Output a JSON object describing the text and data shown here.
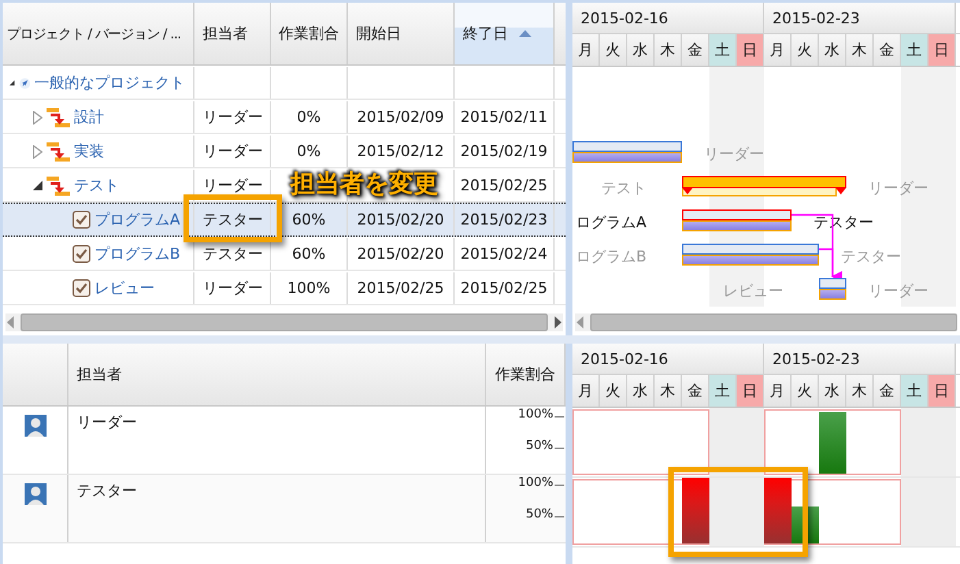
{
  "top_grid": {
    "columns": [
      {
        "label": "プロジェクト / バージョン / ...",
        "sorted": false
      },
      {
        "label": "担当者",
        "sorted": false
      },
      {
        "label": "作業割合",
        "sorted": false
      },
      {
        "label": "開始日",
        "sorted": false
      },
      {
        "label": "終了日",
        "sorted": true
      }
    ],
    "rows": [
      {
        "kind": "project",
        "name": "一般的なプロジェクト",
        "expanded": true,
        "selected": false,
        "children": [
          {
            "kind": "version",
            "name": "設計",
            "expanded": false,
            "selected": false,
            "assignee": "リーダー",
            "ratio": "0%",
            "start": "2015/02/09",
            "end": "2015/02/11"
          },
          {
            "kind": "version",
            "name": "実装",
            "expanded": false,
            "selected": false,
            "assignee": "リーダー",
            "ratio": "0%",
            "start": "2015/02/12",
            "end": "2015/02/19",
            "gantt_right": "リーダー"
          },
          {
            "kind": "version",
            "name": "テスト",
            "expanded": true,
            "selected": false,
            "assignee": "リーダー",
            "end": "2015/02/25",
            "gantt_left": "テスト",
            "gantt_right": "リーダー",
            "children": [
              {
                "kind": "task",
                "name": "プログラムA",
                "selected": true,
                "highlighted": true,
                "link_to_last": true,
                "assignee": "テスター",
                "ratio": "60%",
                "start": "2015/02/20",
                "end": "2015/02/23",
                "gantt_left": "ログラムA",
                "gantt_right": "テスター"
              },
              {
                "kind": "task",
                "name": "プログラムB",
                "selected": false,
                "highlighted": false,
                "link_to_last": true,
                "assignee": "テスター",
                "ratio": "60%",
                "start": "2015/02/20",
                "end": "2015/02/24",
                "gantt_left": "ログラムB",
                "gantt_right": "テスター"
              },
              {
                "kind": "task",
                "name": "レビュー",
                "selected": false,
                "highlighted": false,
                "link_to_last": false,
                "assignee": "リーダー",
                "ratio": "100%",
                "start": "2015/02/25",
                "end": "2015/02/25",
                "gantt_left": "レビュー",
                "gantt_right": "リーダー"
              }
            ]
          }
        ]
      }
    ]
  },
  "top_gantt": {
    "weeks": [
      {
        "label": "2015-02-16",
        "days": [
          {
            "label": "月",
            "kind": "weekday"
          },
          {
            "label": "火",
            "kind": "weekday"
          },
          {
            "label": "水",
            "kind": "weekday"
          },
          {
            "label": "木",
            "kind": "weekday"
          },
          {
            "label": "金",
            "kind": "weekday"
          },
          {
            "label": "土",
            "kind": "saturday"
          },
          {
            "label": "日",
            "kind": "sunday"
          }
        ]
      },
      {
        "label": "2015-02-23",
        "days": [
          {
            "label": "月",
            "kind": "weekday"
          },
          {
            "label": "火",
            "kind": "weekday"
          },
          {
            "label": "水",
            "kind": "weekday"
          },
          {
            "label": "木",
            "kind": "weekday"
          },
          {
            "label": "金",
            "kind": "weekday"
          },
          {
            "label": "土",
            "kind": "saturday"
          },
          {
            "label": "日",
            "kind": "sunday"
          }
        ]
      }
    ]
  },
  "callout": "担当者を変更",
  "resource_grid": {
    "columns": [
      "担当者",
      "作業割合"
    ],
    "resources": [
      {
        "name": "リーダー",
        "highlighted": false,
        "scale": [
          "100%",
          "50%"
        ]
      },
      {
        "name": "テスター",
        "highlighted": true,
        "scale": [
          "100%",
          "50%"
        ]
      }
    ]
  },
  "bottom_gantt": {
    "weeks": [
      {
        "label": "2015-02-16",
        "days": [
          {
            "label": "月",
            "kind": "weekday"
          },
          {
            "label": "火",
            "kind": "weekday"
          },
          {
            "label": "水",
            "kind": "weekday"
          },
          {
            "label": "木",
            "kind": "weekday"
          },
          {
            "label": "金",
            "kind": "weekday"
          },
          {
            "label": "土",
            "kind": "saturday"
          },
          {
            "label": "日",
            "kind": "sunday"
          }
        ]
      },
      {
        "label": "2015-02-23",
        "days": [
          {
            "label": "月",
            "kind": "weekday"
          },
          {
            "label": "火",
            "kind": "weekday"
          },
          {
            "label": "水",
            "kind": "weekday"
          },
          {
            "label": "木",
            "kind": "weekday"
          },
          {
            "label": "金",
            "kind": "weekday"
          },
          {
            "label": "土",
            "kind": "saturday"
          },
          {
            "label": "日",
            "kind": "sunday"
          }
        ]
      }
    ]
  }
}
